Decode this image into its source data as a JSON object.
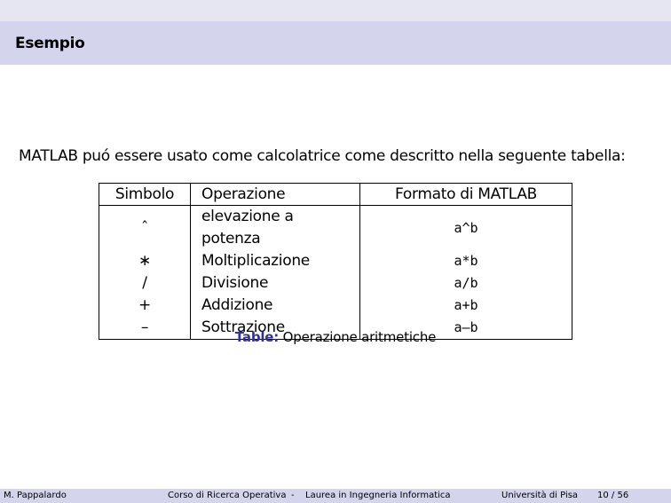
{
  "slide": {
    "title": "Esempio",
    "intro": "MATLAB puó essere usato come calcolatrice come descritto nella seguente tabella:"
  },
  "table": {
    "headers": [
      "Simbolo",
      "Operazione",
      "Formato di MATLAB"
    ],
    "rows": [
      {
        "symbol": "ˆ",
        "operation": "elevazione a potenza",
        "matlab": "a^b"
      },
      {
        "symbol": "∗",
        "operation": "Moltiplicazione",
        "matlab": "a*b"
      },
      {
        "symbol": "/",
        "operation": "Divisione",
        "matlab": "a/b"
      },
      {
        "symbol": "+",
        "operation": "Addizione",
        "matlab": "a+b"
      },
      {
        "symbol": "–",
        "operation": "Sottrazione",
        "matlab": "a–b"
      }
    ],
    "caption_label": "Table:",
    "caption_text": "Operazione aritmetiche"
  },
  "footer": {
    "author": "M. Pappalardo",
    "course": "Corso di Ricerca Operativa",
    "separator": "-",
    "degree": "Laurea in Ingegneria Informatica",
    "university": "Università di Pisa",
    "page": "10 / 56"
  },
  "colors": {
    "title_bar": "#d4d4ed",
    "top_band": "#e6e6f3",
    "caption_label": "#33338f"
  }
}
